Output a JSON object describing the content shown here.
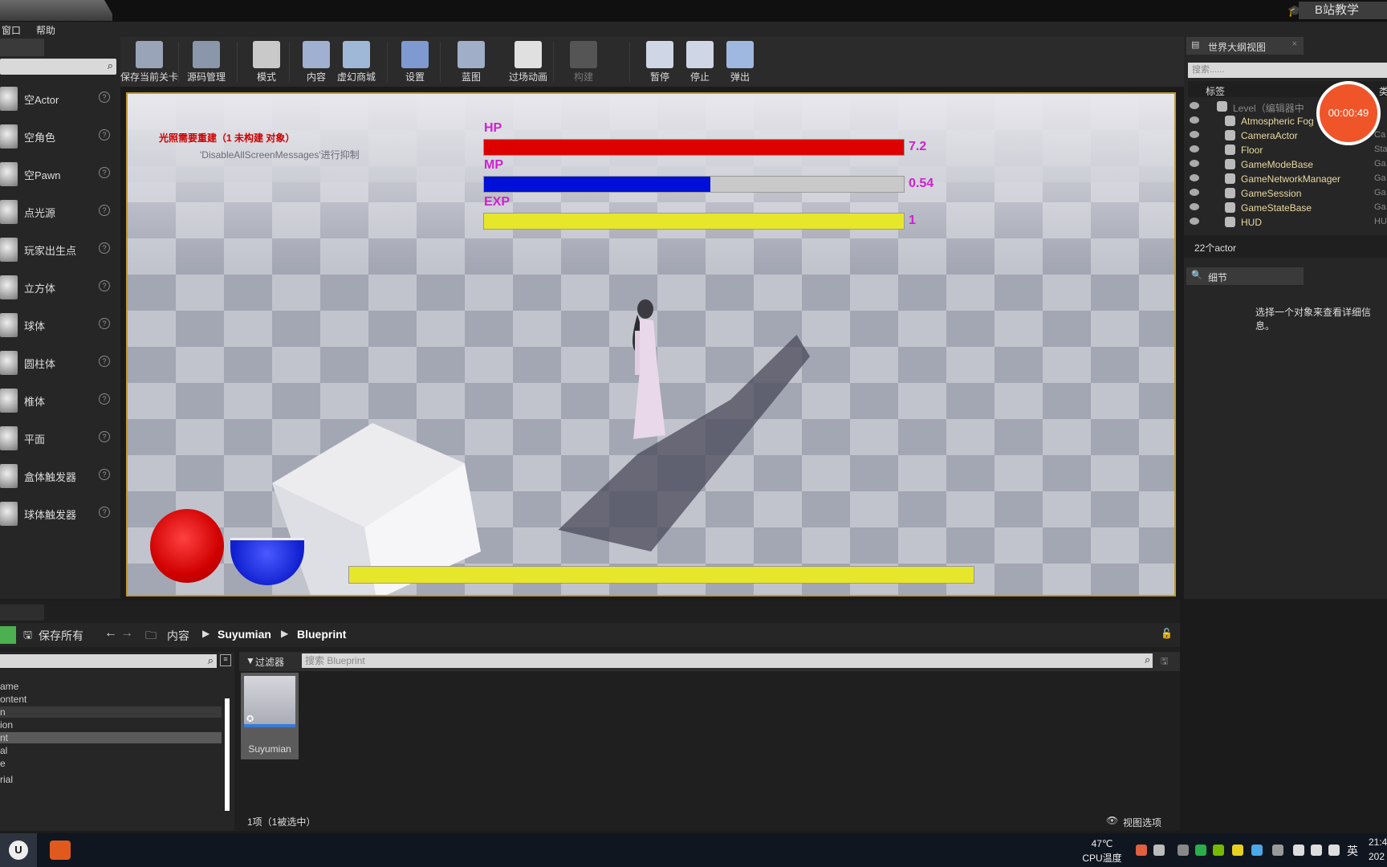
{
  "titlebar": {
    "badge": "B站教学"
  },
  "menubar": {
    "items": [
      "窗口",
      "帮助"
    ]
  },
  "place_panel": {
    "items": [
      {
        "label": "空Actor",
        "help": "?"
      },
      {
        "label": "空角色",
        "help": "?"
      },
      {
        "label": "空Pawn",
        "help": "?"
      },
      {
        "label": "点光源",
        "help": "?"
      },
      {
        "label": "玩家出生点",
        "help": "?"
      },
      {
        "label": "立方体",
        "help": "?"
      },
      {
        "label": "球体",
        "help": "?"
      },
      {
        "label": "圆柱体",
        "help": "?"
      },
      {
        "label": "椎体",
        "help": "?"
      },
      {
        "label": "平面",
        "help": "?"
      },
      {
        "label": "盒体触发器",
        "help": "?"
      },
      {
        "label": "球体触发器",
        "help": "?"
      }
    ]
  },
  "toolbar": {
    "buttons": [
      {
        "label": "保存当前关卡",
        "icon": "save-icon"
      },
      {
        "label": "源码管理",
        "icon": "source-control-icon"
      },
      {
        "label": "模式",
        "icon": "modes-icon"
      },
      {
        "label": "内容",
        "icon": "content-icon"
      },
      {
        "label": "虚幻商城",
        "icon": "marketplace-icon"
      },
      {
        "label": "设置",
        "icon": "settings-icon"
      },
      {
        "label": "蓝图",
        "icon": "blueprint-icon"
      },
      {
        "label": "过场动画",
        "icon": "cinematics-icon"
      },
      {
        "label": "构建",
        "icon": "build-icon"
      },
      {
        "label": "暂停",
        "icon": "pause-icon"
      },
      {
        "label": "停止",
        "icon": "stop-icon"
      },
      {
        "label": "弹出",
        "icon": "eject-icon"
      }
    ]
  },
  "viewport": {
    "warning_line1": "光照需要重建（1 未构建 对象）",
    "warning_line2": "'DisableAllScreenMessages'进行抑制",
    "hud": {
      "hp": {
        "label": "HP",
        "value": "7.2",
        "fraction": 1.0,
        "color": "#dd0000"
      },
      "mp": {
        "label": "MP",
        "value": "0.54",
        "fraction": 0.54,
        "color": "#0010d8"
      },
      "exp": {
        "label": "EXP",
        "value": "1",
        "fraction": 1.0,
        "color": "#e6e62a"
      }
    }
  },
  "outliner": {
    "tab": "世界大纲视图",
    "search_placeholder": "搜索......",
    "col_label": "标签",
    "col_type": "类",
    "rows": [
      {
        "name": "Level（编辑器中",
        "type": ""
      },
      {
        "name": "Atmospheric Fog",
        "type": ""
      },
      {
        "name": "CameraActor",
        "type": "Ca"
      },
      {
        "name": "Floor",
        "type": "Sta"
      },
      {
        "name": "GameModeBase",
        "type": "Ga"
      },
      {
        "name": "GameNetworkManager",
        "type": "Ga"
      },
      {
        "name": "GameSession",
        "type": "Ga"
      },
      {
        "name": "GameStateBase",
        "type": "Ga"
      },
      {
        "name": "HUD",
        "type": "HU"
      }
    ],
    "count": "22个actor",
    "recorder_time": "00:00:49"
  },
  "details": {
    "tab": "细节",
    "message": "选择一个对象来查看详细信息。"
  },
  "content_browser": {
    "save_all": "保存所有",
    "path": [
      "内容",
      "Suyumian",
      "Blueprint"
    ],
    "filter_label": "过滤器",
    "search_placeholder": "搜索 Blueprint",
    "tree": [
      "ame",
      "ontent",
      "n",
      "ion",
      "nt",
      "al",
      "e",
      "rial"
    ],
    "asset_name": "Suyumian",
    "status": "1项（1被选中）",
    "view_options": "视图选项"
  },
  "taskbar": {
    "temp": "47℃",
    "temp_label": "CPU温度",
    "lang": "英",
    "time": "21:4",
    "date": "202"
  }
}
